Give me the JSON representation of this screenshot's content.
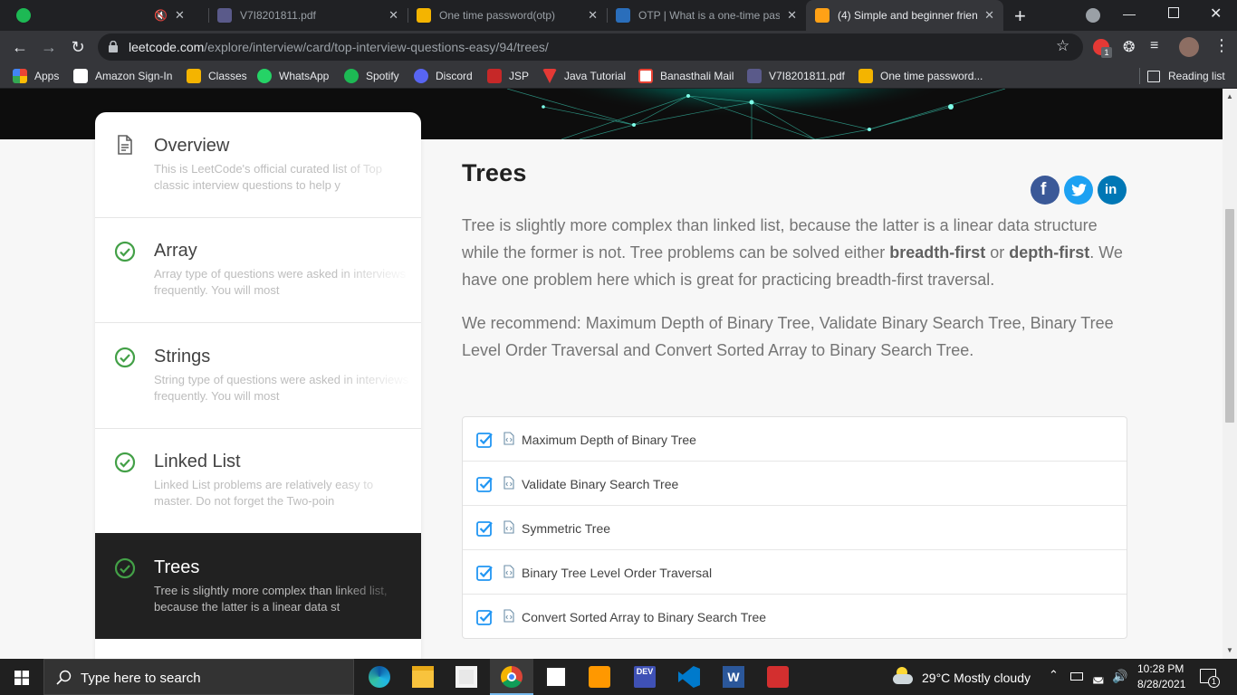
{
  "browser": {
    "tabs": [
      {
        "title": "",
        "active": false,
        "favicon_color": "#1DB954"
      },
      {
        "title": "",
        "active": false,
        "favicon_color": "#777777"
      },
      {
        "title": "V7I8201811.pdf",
        "active": false,
        "favicon_color": "#5a5a8a"
      },
      {
        "title": "One time password(otp)",
        "active": false,
        "favicon_color": "#f4b400"
      },
      {
        "title": "OTP | What is a one-time pas",
        "active": false,
        "favicon_color": "#2a6ebb"
      },
      {
        "title": "(4) Simple and beginner frien",
        "active": true,
        "favicon_color": "#ffa116"
      }
    ],
    "url_host": "leetcode.com",
    "url_path": "/explore/interview/card/top-interview-questions-easy/94/trees/",
    "bookmarks": [
      {
        "label": "Apps",
        "icon": "apps-grid-icon",
        "color": "#ea4335"
      },
      {
        "label": "Amazon Sign-In",
        "icon": "amazon-icon",
        "color": "#ffffff"
      },
      {
        "label": "Classes",
        "icon": "classroom-icon",
        "color": "#f4b400"
      },
      {
        "label": "WhatsApp",
        "icon": "whatsapp-icon",
        "color": "#25d366"
      },
      {
        "label": "Spotify",
        "icon": "spotify-icon",
        "color": "#1db954"
      },
      {
        "label": "Discord",
        "icon": "discord-icon",
        "color": "#5865f2"
      },
      {
        "label": "JSP",
        "icon": "jsp-icon",
        "color": "#c62828"
      },
      {
        "label": "Java Tutorial",
        "icon": "java-tutorial-icon",
        "color": "#e53935"
      },
      {
        "label": "Banasthali Mail",
        "icon": "gmail-icon",
        "color": "#ea4335"
      },
      {
        "label": "V7I8201811.pdf",
        "icon": "pdf-icon",
        "color": "#5a5a8a"
      },
      {
        "label": "One time password...",
        "icon": "otp-icon",
        "color": "#f4b400"
      }
    ],
    "reading_list": "Reading list",
    "extension_badge": "1"
  },
  "sidebar": {
    "cards": [
      {
        "title": "Overview",
        "desc": "This is LeetCode's official curated list of Top classic interview questions to help y",
        "icon": "document-icon",
        "active": false
      },
      {
        "title": "Array",
        "desc": "Array type of questions were asked in interviews frequently. You will most",
        "icon": "check-circle-icon",
        "active": false
      },
      {
        "title": "Strings",
        "desc": "String type of questions were asked in interviews frequently. You will most",
        "icon": "check-circle-icon",
        "active": false
      },
      {
        "title": "Linked List",
        "desc": "Linked List problems are relatively easy to master. Do not forget the Two-poin",
        "icon": "check-circle-icon",
        "active": false
      },
      {
        "title": "Trees",
        "desc": "Tree is slightly more complex than linked list, because the latter is a linear data st",
        "icon": "check-circle-icon",
        "active": true
      }
    ]
  },
  "main": {
    "title": "Trees",
    "para1_part1": "Tree is slightly more complex than linked list, because the latter is a linear data structure while the former is not. Tree problems can be solved either ",
    "para1_bold1": "breadth-first",
    "para1_part2": " or ",
    "para1_bold2": "depth-first",
    "para1_part3": ". We have one problem here which is great for practicing breadth-first traversal.",
    "para2": "We recommend: Maximum Depth of Binary Tree, Validate Binary Search Tree, Binary Tree Level Order Traversal and Convert Sorted Array to Binary Search Tree.",
    "share": [
      {
        "name": "facebook-share-button",
        "glyph": "f",
        "color": "#3b5998"
      },
      {
        "name": "twitter-share-button",
        "glyph": "t",
        "color": "#1da1f2"
      },
      {
        "name": "linkedin-share-button",
        "glyph": "in",
        "color": "#0077b5"
      }
    ],
    "problems": [
      {
        "label": "Maximum Depth of Binary Tree",
        "completed": true
      },
      {
        "label": "Validate Binary Search Tree",
        "completed": true
      },
      {
        "label": "Symmetric Tree",
        "completed": true
      },
      {
        "label": "Binary Tree Level Order Traversal",
        "completed": true
      },
      {
        "label": "Convert Sorted Array to Binary Search Tree",
        "completed": true
      }
    ]
  },
  "taskbar": {
    "search_placeholder": "Type here to search",
    "weather": "29°C  Mostly cloudy",
    "time": "10:28 PM",
    "date": "8/28/2021",
    "notification_count": "1",
    "apps": [
      "edge-icon",
      "file-explorer-icon",
      "store-icon",
      "chrome-icon",
      "ide-icon",
      "sublime-icon",
      "dev-cpp-icon",
      "vscode-icon",
      "word-icon",
      "acrobat-icon"
    ]
  },
  "colors": {
    "check_green": "#43a047",
    "problem_check": "#2196f3",
    "active_card": "#212121",
    "banner_teal": "#00b894"
  }
}
